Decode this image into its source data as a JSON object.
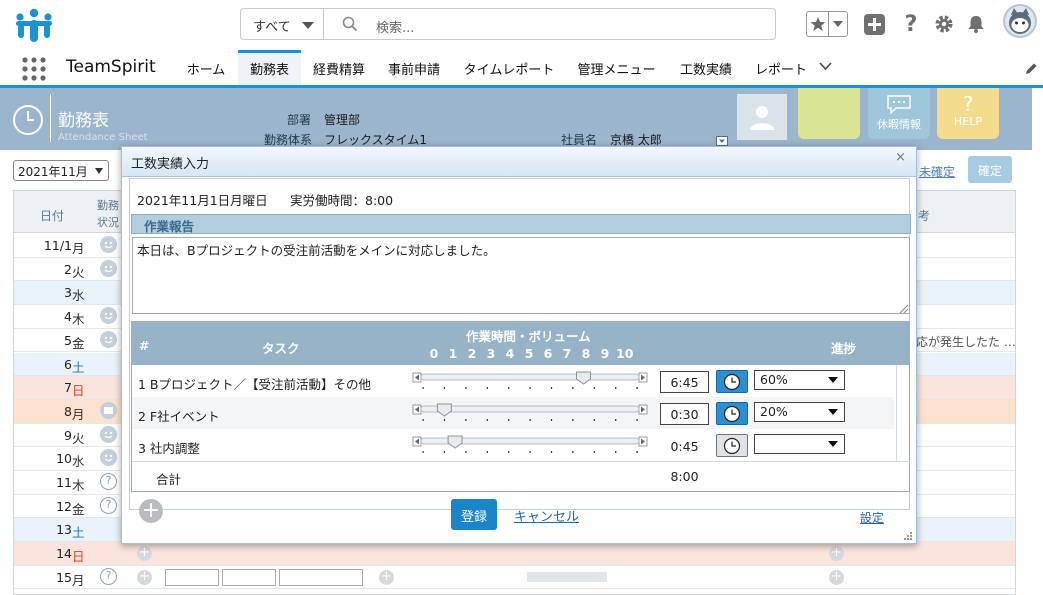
{
  "global_header": {
    "scope_label": "すべて",
    "search_placeholder": "検索..."
  },
  "nav": {
    "app_name": "TeamSpirit",
    "tabs": [
      "ホーム",
      "勤務表",
      "経費精算",
      "事前申請",
      "タイムレポート",
      "管理メニュー",
      "工数実績",
      "レポート"
    ],
    "active_tab": "勤務表"
  },
  "attendance": {
    "title": "勤務表",
    "subtitle": "Attendance Sheet",
    "dept_label": "部署",
    "dept_value": "管理部",
    "work_type_label": "勤務体系",
    "work_type_value": "フレックスタイム1",
    "employee_label": "社員名",
    "employee_value": "京橋 太郎",
    "leave_button": "休暇情報",
    "help_button": "HELP",
    "help_glyph": "?",
    "month": "2021年11月",
    "unconfirmed_link": "未確定",
    "confirm_button": "確定"
  },
  "table": {
    "headers": {
      "date": "日付",
      "status_line1": "勤務",
      "status_line2": "状況",
      "note_suffix": "考"
    },
    "note_row5": "応が発生したた …",
    "rows": [
      {
        "day": "11/1",
        "dow": "月",
        "kind": "weekday",
        "status": "smile"
      },
      {
        "day": "2",
        "dow": "火",
        "kind": "weekday",
        "status": "smile"
      },
      {
        "day": "3",
        "dow": "水",
        "kind": "holiday",
        "status": "none"
      },
      {
        "day": "4",
        "dow": "木",
        "kind": "weekday",
        "status": "smile"
      },
      {
        "day": "5",
        "dow": "金",
        "kind": "weekday",
        "status": "smile"
      },
      {
        "day": "6",
        "dow": "土",
        "kind": "saturday",
        "status": "none"
      },
      {
        "day": "7",
        "dow": "日",
        "kind": "sunday",
        "status": "none"
      },
      {
        "day": "8",
        "dow": "月",
        "kind": "leave",
        "status": "leave"
      },
      {
        "day": "9",
        "dow": "火",
        "kind": "weekday",
        "status": "smile"
      },
      {
        "day": "10",
        "dow": "水",
        "kind": "weekday",
        "status": "smile"
      },
      {
        "day": "11",
        "dow": "木",
        "kind": "weekday",
        "status": "question"
      },
      {
        "day": "12",
        "dow": "金",
        "kind": "weekday",
        "status": "question"
      },
      {
        "day": "13",
        "dow": "土",
        "kind": "saturday",
        "status": "none"
      },
      {
        "day": "14",
        "dow": "日",
        "kind": "sunday",
        "status": "none"
      },
      {
        "day": "15",
        "dow": "月",
        "kind": "weekday",
        "status": "question"
      }
    ]
  },
  "dialog": {
    "title": "工数実績入力",
    "close": "×",
    "date": "2021年11月1日月曜日",
    "actual_hours": "実労働時間：8:00",
    "report_header": "作業報告",
    "report_text": "本日は、Bプロジェクトの受注前活動をメインに対応しました。",
    "columns": {
      "num": "#",
      "task": "タスク",
      "volume": "作業時間・ボリューム",
      "progress": "進捗"
    },
    "scale": [
      "0",
      "1",
      "2",
      "3",
      "4",
      "5",
      "6",
      "7",
      "8",
      "9",
      "10"
    ],
    "tasks": [
      {
        "no": "1",
        "name": "Bプロジェクト／【受注前活動】その他",
        "time": "6:45",
        "slider_value": 7.5,
        "timer_active": true,
        "progress": "60%",
        "editable": true
      },
      {
        "no": "2",
        "name": "F社イベント",
        "time": "0:30",
        "slider_value": 1.0,
        "timer_active": true,
        "progress": "20%",
        "editable": true
      },
      {
        "no": "3",
        "name": "社内調整",
        "time": "0:45",
        "slider_value": 1.5,
        "timer_active": false,
        "progress": "",
        "editable": false
      }
    ],
    "total_label": "合計",
    "total_time": "8:00",
    "register_button": "登録",
    "cancel_link": "キャンセル",
    "settings_link": "設定"
  },
  "colors": {
    "brand_blue": "#1b93d2",
    "header_band": "#9bb5cc",
    "saturday_row": "#eaf2fa",
    "sunday_row": "#fbe4dd",
    "leave_row": "#fde3cf",
    "holiday_row": "#eaf2fa",
    "register_button": "#1b85c9"
  }
}
